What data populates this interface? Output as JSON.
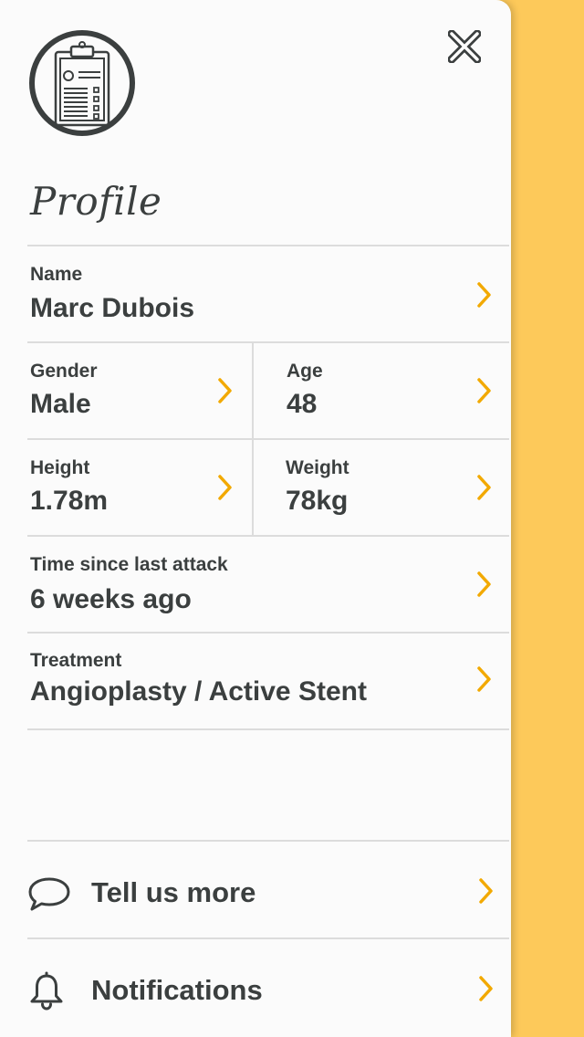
{
  "profile": {
    "title": "Profile",
    "fields": {
      "name": {
        "label": "Name",
        "value": "Marc Dubois"
      },
      "gender": {
        "label": "Gender",
        "value": "Male"
      },
      "age": {
        "label": "Age",
        "value": "48"
      },
      "height": {
        "label": "Height",
        "value": "1.78m"
      },
      "weight": {
        "label": "Weight",
        "value": "78kg"
      },
      "time_since_attack": {
        "label": "Time since last attack",
        "value": "6 weeks ago"
      },
      "treatment": {
        "label": "Treatment",
        "value": "Angioplasty / Active Stent"
      }
    }
  },
  "menu": {
    "tell_us_more": "Tell us more",
    "notifications": "Notifications"
  },
  "icons": {
    "logo": "clipboard-icon",
    "close": "close-icon",
    "chevron": "chevron-right-icon",
    "feedback": "speech-bubble-icon",
    "notifications": "bell-icon"
  },
  "colors": {
    "accent": "#F2A900",
    "background": "#FDC95A",
    "panel": "#FBFBFB",
    "text": "#3B3F3F",
    "divider": "#DCDCDC"
  }
}
